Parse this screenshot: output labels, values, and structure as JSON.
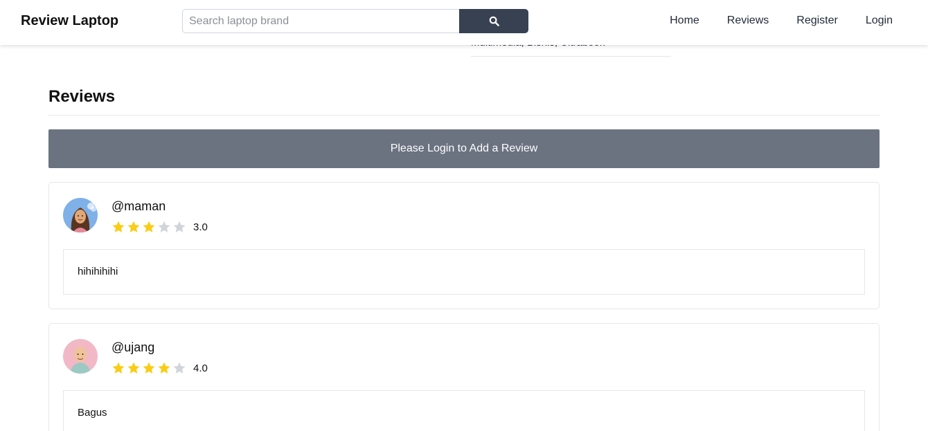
{
  "page": {
    "scrolled_text": "Multimedia, Bisnis, Ultrabook"
  },
  "navbar": {
    "brand": "Review Laptop",
    "search_placeholder": "Search laptop brand",
    "search_icon": "search-icon",
    "links": [
      "Home",
      "Reviews",
      "Register",
      "Login"
    ]
  },
  "reviews_section": {
    "title": "Reviews",
    "login_prompt": "Please Login to Add a Review",
    "reviews": [
      {
        "username": "@maman",
        "rating": 3,
        "rating_label": "3.0",
        "text": "hihihihihi",
        "avatar_icon": "woman-avatar"
      },
      {
        "username": "@ujang",
        "rating": 4,
        "rating_label": "4.0",
        "text": "Bagus",
        "avatar_icon": "man-avatar"
      }
    ]
  },
  "colors": {
    "star_filled": "#facc15",
    "star_empty": "#d1d5db",
    "banner": "#6b7280",
    "search_button": "#374151"
  }
}
